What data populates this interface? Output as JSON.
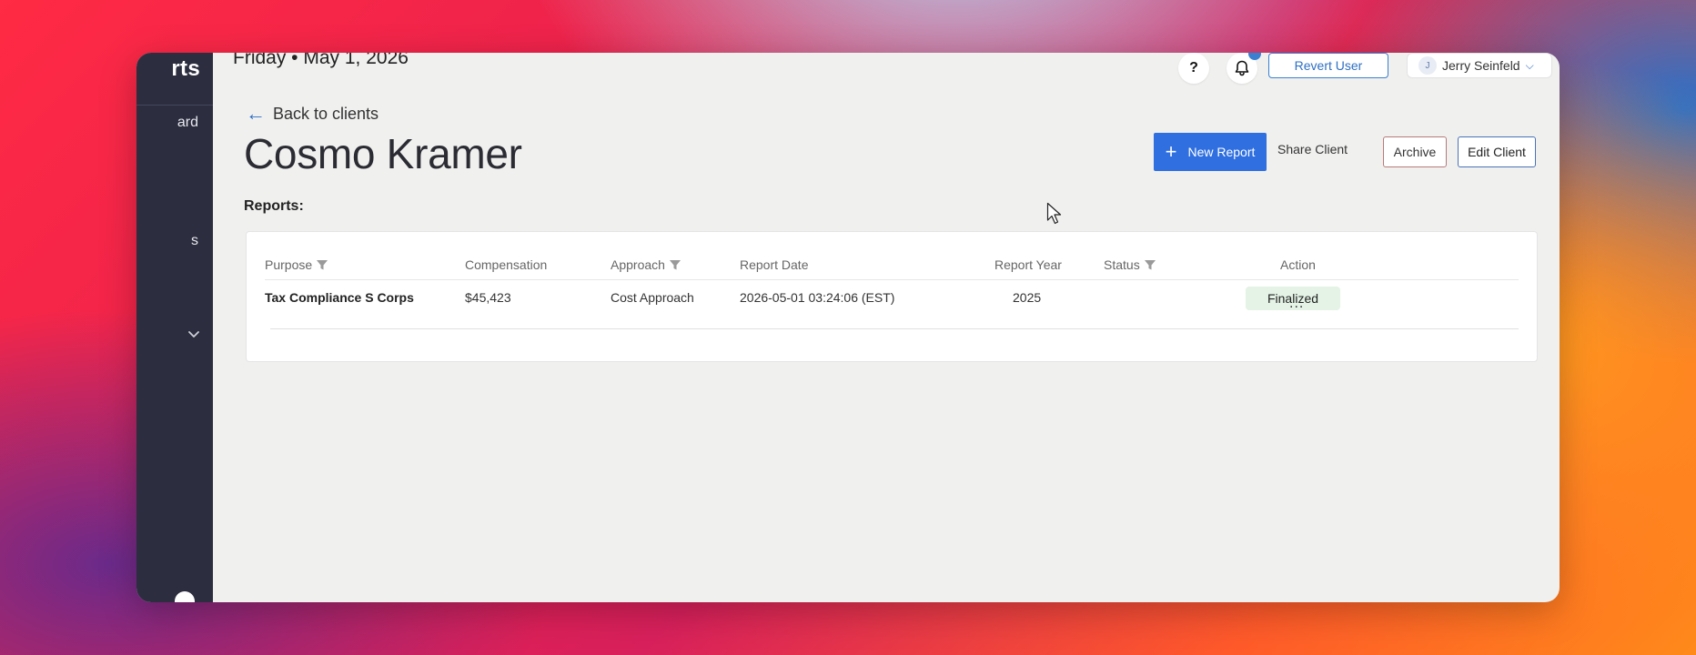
{
  "header": {
    "date": "Friday • May 1, 2026",
    "help_label": "?",
    "revert_user_label": "Revert User",
    "user_initial": "J",
    "user_name": "Jerry Seinfeld"
  },
  "sidebar": {
    "brand": "rts",
    "items": [
      {
        "label": "ard"
      },
      {
        "label": "s"
      }
    ]
  },
  "page": {
    "back_label": "Back to clients",
    "client_name": "Cosmo Kramer",
    "reports_label": "Reports:"
  },
  "actions": {
    "new_report": "New Report",
    "share_client": "Share Client",
    "archive": "Archive",
    "edit_client": "Edit Client"
  },
  "table": {
    "columns": [
      "Purpose",
      "Compensation",
      "Approach",
      "Report Date",
      "Report Year",
      "Status",
      "Action"
    ],
    "rows": [
      {
        "purpose": "Tax Compliance S Corps",
        "compensation": "$45,423",
        "approach": "Cost Approach",
        "report_date": "2026-05-01 03:24:06 (EST)",
        "report_year": "2025",
        "status": "Finalized",
        "action": "..."
      }
    ]
  },
  "colors": {
    "accent": "#2f6fe0",
    "sidebar_bg": "#2c2d3f",
    "status_finalized_bg": "#e4f3e6"
  }
}
